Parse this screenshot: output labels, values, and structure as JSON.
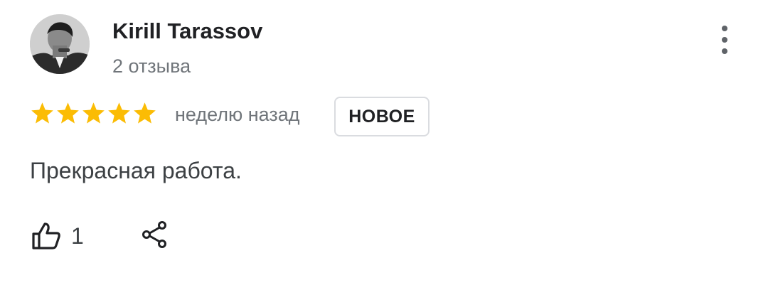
{
  "review": {
    "author": {
      "name": "Kirill Tarassov",
      "reviews_count": "2 отзыва",
      "avatar_icon": "user-photo-avatar"
    },
    "rating": 5,
    "rating_max": 5,
    "star_color": "#fbbc04",
    "time_ago": "неделю назад",
    "badge": "НОВОЕ",
    "text": "Прекрасная работа.",
    "likes": "1"
  },
  "icons": {
    "more": "more-vert-icon",
    "star": "star-icon",
    "like": "thumbs-up-icon",
    "share": "share-icon"
  }
}
